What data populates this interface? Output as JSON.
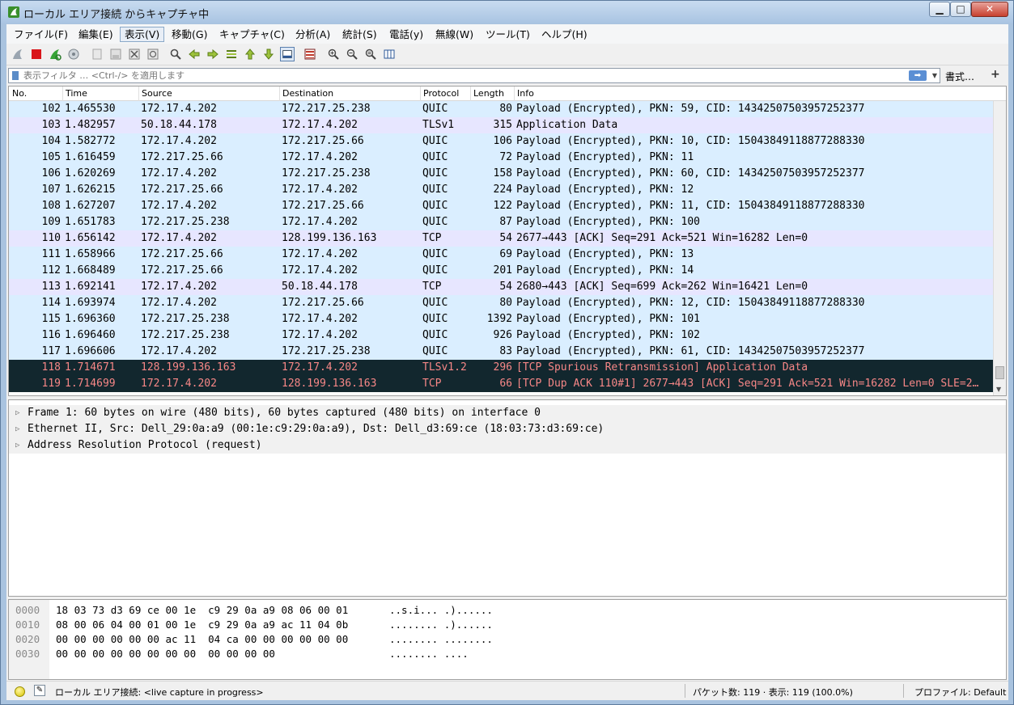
{
  "window": {
    "title": "ローカル エリア接続 からキャプチャ中",
    "minimize": "▁",
    "maximize": "□",
    "close": "✕"
  },
  "menu": [
    {
      "label": "ファイル(F)"
    },
    {
      "label": "編集(E)"
    },
    {
      "label": "表示(V)"
    },
    {
      "label": "移動(G)"
    },
    {
      "label": "キャプチャ(C)"
    },
    {
      "label": "分析(A)"
    },
    {
      "label": "統計(S)"
    },
    {
      "label": "電話(y)"
    },
    {
      "label": "無線(W)"
    },
    {
      "label": "ツール(T)"
    },
    {
      "label": "ヘルプ(H)"
    }
  ],
  "toolbar": {
    "icons": [
      "shark-fin-start-icon",
      "stop-icon",
      "restart-icon",
      "options-gear-icon",
      "open-file-icon",
      "save-file-icon",
      "close-file-icon",
      "reload-icon",
      "find-icon",
      "go-back-icon",
      "go-forward-icon",
      "go-to-packet-icon",
      "go-first-icon",
      "go-last-icon",
      "autoscroll-icon",
      "colorize-icon",
      "zoom-in-icon",
      "zoom-out-icon",
      "zoom-reset-icon",
      "resize-columns-icon"
    ]
  },
  "filter": {
    "placeholder": "表示フィルタ … <Ctrl-/> を適用します",
    "apply_arrow": "➡",
    "dropdown_arrow": "▼",
    "expression_label": "書式…",
    "add_label": "+"
  },
  "packet_list": {
    "columns": [
      "No.",
      "Time",
      "Source",
      "Destination",
      "Protocol",
      "Length",
      "Info"
    ],
    "rows": [
      {
        "no": "102",
        "time": "1.465530",
        "src": "172.17.4.202",
        "dst": "172.217.25.238",
        "proto": "QUIC",
        "len": "80",
        "info": "Payload (Encrypted), PKN: 59, CID: 14342507503957252377",
        "kind": "quic"
      },
      {
        "no": "103",
        "time": "1.482957",
        "src": "50.18.44.178",
        "dst": "172.17.4.202",
        "proto": "TLSv1",
        "len": "315",
        "info": "Application Data",
        "kind": "tcp"
      },
      {
        "no": "104",
        "time": "1.582772",
        "src": "172.17.4.202",
        "dst": "172.217.25.66",
        "proto": "QUIC",
        "len": "106",
        "info": "Payload (Encrypted), PKN: 10, CID: 15043849118877288330",
        "kind": "quic"
      },
      {
        "no": "105",
        "time": "1.616459",
        "src": "172.217.25.66",
        "dst": "172.17.4.202",
        "proto": "QUIC",
        "len": "72",
        "info": "Payload (Encrypted), PKN: 11",
        "kind": "quic"
      },
      {
        "no": "106",
        "time": "1.620269",
        "src": "172.17.4.202",
        "dst": "172.217.25.238",
        "proto": "QUIC",
        "len": "158",
        "info": "Payload (Encrypted), PKN: 60, CID: 14342507503957252377",
        "kind": "quic"
      },
      {
        "no": "107",
        "time": "1.626215",
        "src": "172.217.25.66",
        "dst": "172.17.4.202",
        "proto": "QUIC",
        "len": "224",
        "info": "Payload (Encrypted), PKN: 12",
        "kind": "quic"
      },
      {
        "no": "108",
        "time": "1.627207",
        "src": "172.17.4.202",
        "dst": "172.217.25.66",
        "proto": "QUIC",
        "len": "122",
        "info": "Payload (Encrypted), PKN: 11, CID: 15043849118877288330",
        "kind": "quic"
      },
      {
        "no": "109",
        "time": "1.651783",
        "src": "172.217.25.238",
        "dst": "172.17.4.202",
        "proto": "QUIC",
        "len": "87",
        "info": "Payload (Encrypted), PKN: 100",
        "kind": "quic"
      },
      {
        "no": "110",
        "time": "1.656142",
        "src": "172.17.4.202",
        "dst": "128.199.136.163",
        "proto": "TCP",
        "len": "54",
        "info": "2677→443 [ACK] Seq=291 Ack=521 Win=16282 Len=0",
        "kind": "tcp"
      },
      {
        "no": "111",
        "time": "1.658966",
        "src": "172.217.25.66",
        "dst": "172.17.4.202",
        "proto": "QUIC",
        "len": "69",
        "info": "Payload (Encrypted), PKN: 13",
        "kind": "quic"
      },
      {
        "no": "112",
        "time": "1.668489",
        "src": "172.217.25.66",
        "dst": "172.17.4.202",
        "proto": "QUIC",
        "len": "201",
        "info": "Payload (Encrypted), PKN: 14",
        "kind": "quic"
      },
      {
        "no": "113",
        "time": "1.692141",
        "src": "172.17.4.202",
        "dst": "50.18.44.178",
        "proto": "TCP",
        "len": "54",
        "info": "2680→443 [ACK] Seq=699 Ack=262 Win=16421 Len=0",
        "kind": "tcp"
      },
      {
        "no": "114",
        "time": "1.693974",
        "src": "172.17.4.202",
        "dst": "172.217.25.66",
        "proto": "QUIC",
        "len": "80",
        "info": "Payload (Encrypted), PKN: 12, CID: 15043849118877288330",
        "kind": "quic"
      },
      {
        "no": "115",
        "time": "1.696360",
        "src": "172.217.25.238",
        "dst": "172.17.4.202",
        "proto": "QUIC",
        "len": "1392",
        "info": "Payload (Encrypted), PKN: 101",
        "kind": "quic"
      },
      {
        "no": "116",
        "time": "1.696460",
        "src": "172.217.25.238",
        "dst": "172.17.4.202",
        "proto": "QUIC",
        "len": "926",
        "info": "Payload (Encrypted), PKN: 102",
        "kind": "quic"
      },
      {
        "no": "117",
        "time": "1.696606",
        "src": "172.17.4.202",
        "dst": "172.217.25.238",
        "proto": "QUIC",
        "len": "83",
        "info": "Payload (Encrypted), PKN: 61, CID: 14342507503957252377",
        "kind": "quic"
      },
      {
        "no": "118",
        "time": "1.714671",
        "src": "128.199.136.163",
        "dst": "172.17.4.202",
        "proto": "TLSv1.2",
        "len": "296",
        "info": "[TCP Spurious Retransmission] Application Data",
        "kind": "bad"
      },
      {
        "no": "119",
        "time": "1.714699",
        "src": "172.17.4.202",
        "dst": "128.199.136.163",
        "proto": "TCP",
        "len": "66",
        "info": "[TCP Dup ACK 110#1] 2677→443 [ACK] Seq=291 Ack=521 Win=16282 Len=0 SLE=2…",
        "kind": "bad"
      }
    ]
  },
  "details": [
    {
      "text": "Frame 1: 60 bytes on wire (480 bits), 60 bytes captured (480 bits) on interface 0"
    },
    {
      "text": "Ethernet II, Src: Dell_29:0a:a9 (00:1e:c9:29:0a:a9), Dst: Dell_d3:69:ce (18:03:73:d3:69:ce)"
    },
    {
      "text": "Address Resolution Protocol (request)"
    }
  ],
  "bytes": [
    {
      "off": "0000",
      "hex": "18 03 73 d3 69 ce 00 1e  c9 29 0a a9 08 06 00 01",
      "ascii": "..s.i... .)......"
    },
    {
      "off": "0010",
      "hex": "08 00 06 04 00 01 00 1e  c9 29 0a a9 ac 11 04 0b",
      "ascii": "........ .)......"
    },
    {
      "off": "0020",
      "hex": "00 00 00 00 00 00 ac 11  04 ca 00 00 00 00 00 00",
      "ascii": "........ ........"
    },
    {
      "off": "0030",
      "hex": "00 00 00 00 00 00 00 00  00 00 00 00",
      "ascii": "........ ...."
    }
  ],
  "status": {
    "interface_text": "ローカル エリア接続: <live capture in progress>",
    "packets_text": "パケット数: 119 · 表示: 119 (100.0%)",
    "profile_text": "プロファイル: Default"
  },
  "colors": {
    "quic_row": "#daeeff",
    "tcp_row": "#e7e6ff",
    "bad_row_bg": "#12272e",
    "bad_row_fg": "#f78787"
  }
}
